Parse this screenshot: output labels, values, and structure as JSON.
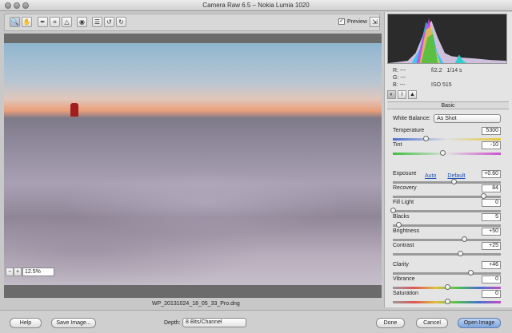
{
  "window": {
    "title": "Camera Raw 6.5  –  Nokia Lumia 1020"
  },
  "toolbar": {
    "tools": [
      {
        "name": "zoom-tool-icon",
        "glyph": "🔍"
      },
      {
        "name": "hand-tool-icon",
        "glyph": "✋"
      },
      {
        "name": "white-balance-tool-icon",
        "glyph": "✒"
      },
      {
        "name": "crop-tool-icon",
        "glyph": "⌗"
      },
      {
        "name": "straighten-tool-icon",
        "glyph": "△"
      },
      {
        "name": "red-eye-tool-icon",
        "glyph": "◉"
      },
      {
        "name": "preferences-icon",
        "glyph": "☰"
      },
      {
        "name": "rotate-left-icon",
        "glyph": "↺"
      },
      {
        "name": "rotate-right-icon",
        "glyph": "↻"
      }
    ],
    "preview_label": "Preview",
    "preview_checked": true
  },
  "canvas": {
    "zoom": "12.5%",
    "filename": "WP_20131024_18_05_33_Pro.dng"
  },
  "info": {
    "r": "R:  ---",
    "g": "G:  ---",
    "b": "B:  ---",
    "aperture": "f/2.2",
    "shutter": "1/14 s",
    "iso": "ISO 515"
  },
  "panel": {
    "section": "Basic",
    "white_balance_label": "White Balance:",
    "white_balance_value": "As Shot",
    "auto": "Auto",
    "default": "Default",
    "sliders": [
      {
        "key": "temperature",
        "label": "Temperature",
        "value": "5300",
        "level": 0.3
      },
      {
        "key": "tint",
        "label": "Tint",
        "value": "-10",
        "level": 0.46
      },
      {
        "key": "exposure",
        "label": "Exposure",
        "value": "+0.60",
        "level": 0.56
      },
      {
        "key": "recovery",
        "label": "Recovery",
        "value": "84",
        "level": 0.84
      },
      {
        "key": "fill-light",
        "label": "Fill Light",
        "value": "0",
        "level": 0.0
      },
      {
        "key": "blacks",
        "label": "Blacks",
        "value": "5",
        "level": 0.05
      },
      {
        "key": "brightness",
        "label": "Brightness",
        "value": "+50",
        "level": 0.66
      },
      {
        "key": "contrast",
        "label": "Contrast",
        "value": "+25",
        "level": 0.62
      },
      {
        "key": "clarity",
        "label": "Clarity",
        "value": "+46",
        "level": 0.72
      },
      {
        "key": "vibrance",
        "label": "Vibrance",
        "value": "0",
        "level": 0.5
      },
      {
        "key": "saturation",
        "label": "Saturation",
        "value": "0",
        "level": 0.5
      }
    ]
  },
  "footer": {
    "help": "Help",
    "save_image": "Save Image...",
    "depth_label": "Depth:",
    "depth_value": "8 Bits/Channel",
    "done": "Done",
    "cancel": "Cancel",
    "open_image": "Open Image"
  },
  "colors": {
    "accent": "#7ea5e0",
    "people": "#a01e1e"
  }
}
